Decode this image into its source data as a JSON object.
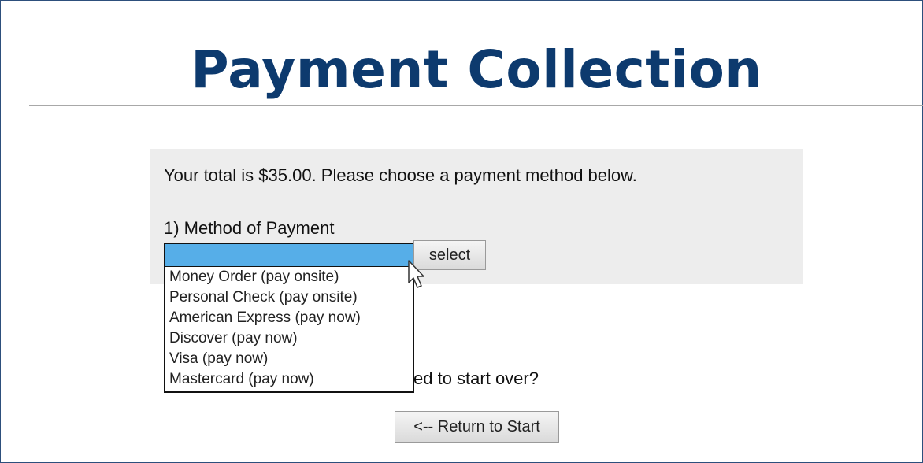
{
  "header": {
    "title": "Payment Collection"
  },
  "panel": {
    "total_text": "Your total is $35.00. Please choose a payment method below.",
    "method_label": "1) Method of Payment",
    "select_button_label": "select",
    "selected_value": ""
  },
  "dropdown": {
    "options": [
      "Money Order (pay onsite)",
      "Personal Check (pay onsite)",
      "American Express (pay now)",
      "Discover (pay now)",
      "Visa (pay now)",
      "Mastercard (pay now)"
    ],
    "highlight_color": "#56aee8"
  },
  "footer": {
    "start_over_visible_text": "ed to start over?",
    "return_button_label": "<-- Return to Start"
  },
  "colors": {
    "title": "#0d3a6e",
    "frame_border": "#2d4f7c",
    "panel_bg": "#ededed"
  },
  "icons": {
    "cursor": "mouse-pointer-icon"
  }
}
